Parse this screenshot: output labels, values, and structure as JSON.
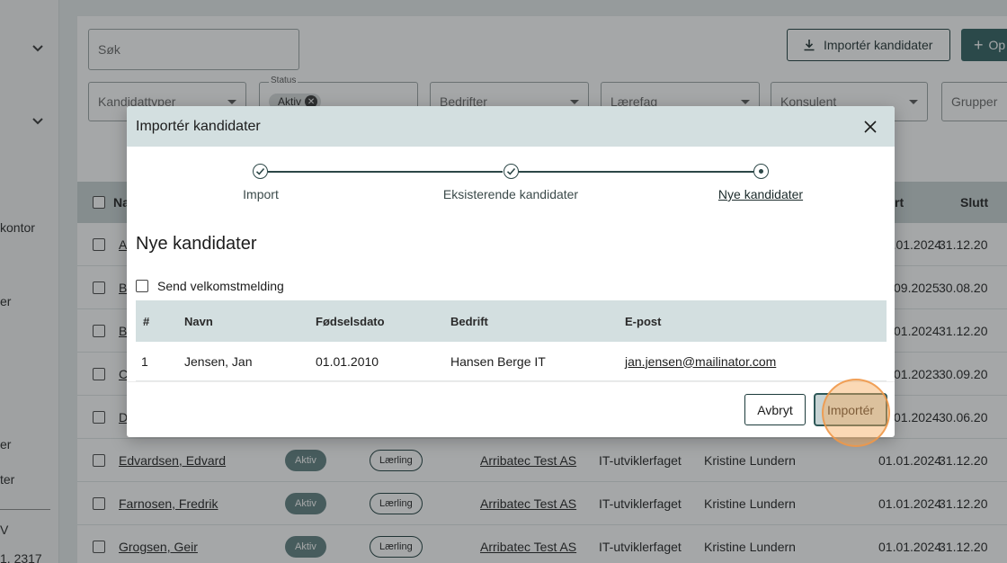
{
  "sidebar": {
    "items": [
      "kontor",
      "er",
      "er",
      "ter",
      "V",
      "1. 2317"
    ]
  },
  "toolbar": {
    "search_placeholder": "Søk",
    "import_label": "Importér kandidater",
    "add_label": "Op"
  },
  "filters": {
    "kandidattyper": "Kandidattyper",
    "status_legend": "Status",
    "status_chip": "Aktiv",
    "bedrifter": "Bedrifter",
    "laerefag": "Lærefag",
    "konsulent": "Konsulent",
    "grupper": "Grupper"
  },
  "table": {
    "headers": {
      "name": "Na",
      "start": "rt",
      "end": "Slutt"
    },
    "rows": [
      {
        "name": "A",
        "start": "01.01.2024",
        "end": "31.12.20"
      },
      {
        "name": "B",
        "start": "09.2025",
        "end": "30.08.20"
      },
      {
        "name": "B",
        "start": "01.2024",
        "end": "31.12.20"
      },
      {
        "name": "C",
        "start": "01.2023",
        "end": "30.09.20"
      },
      {
        "name": "D",
        "start": "01.2024",
        "end": "30.06.20"
      },
      {
        "name": "Edvardsen, Edvard",
        "status": "Aktiv",
        "type": "Lærling",
        "company": "Arribatec Test AS",
        "subject": "IT-utviklerfaget",
        "consultant": "Kristine Lundern",
        "start": "01.01.2024",
        "end": "31.12.20"
      },
      {
        "name": "Farnosen, Fredrik",
        "status": "Aktiv",
        "type": "Lærling",
        "company": "Arribatec Test AS",
        "subject": "IT-utviklerfaget",
        "consultant": "Kristine Lundern",
        "start": "01.01.2024",
        "end": "31.12.20"
      },
      {
        "name": "Grogsen, Geir",
        "status": "Aktiv",
        "type": "Lærling",
        "company": "Arribatec Test AS",
        "subject": "IT-utviklerfaget",
        "consultant": "Kristine Lundern",
        "start": "01.01.2024",
        "end": "31.12.20"
      }
    ]
  },
  "modal": {
    "title": "Importér kandidater",
    "steps": [
      {
        "label": "Import",
        "state": "done"
      },
      {
        "label": "Eksisterende kandidater",
        "state": "done"
      },
      {
        "label": "Nye kandidater",
        "state": "active"
      }
    ],
    "heading": "Nye kandidater",
    "welcome_label": "Send velkomstmelding",
    "columns": [
      "#",
      "Navn",
      "Fødselsdato",
      "Bedrift",
      "E-post"
    ],
    "rows": [
      {
        "num": "1",
        "name": "Jensen, Jan",
        "dob": "01.01.2010",
        "company": "Hansen Berge IT",
        "email": "jan.jensen@mailinator.com"
      }
    ],
    "cancel_label": "Avbryt",
    "import_label": "Importér"
  },
  "colors": {
    "accent": "#2d5e5e",
    "header_bg": "#d3dfe0",
    "highlight": "#f6aa5a"
  }
}
